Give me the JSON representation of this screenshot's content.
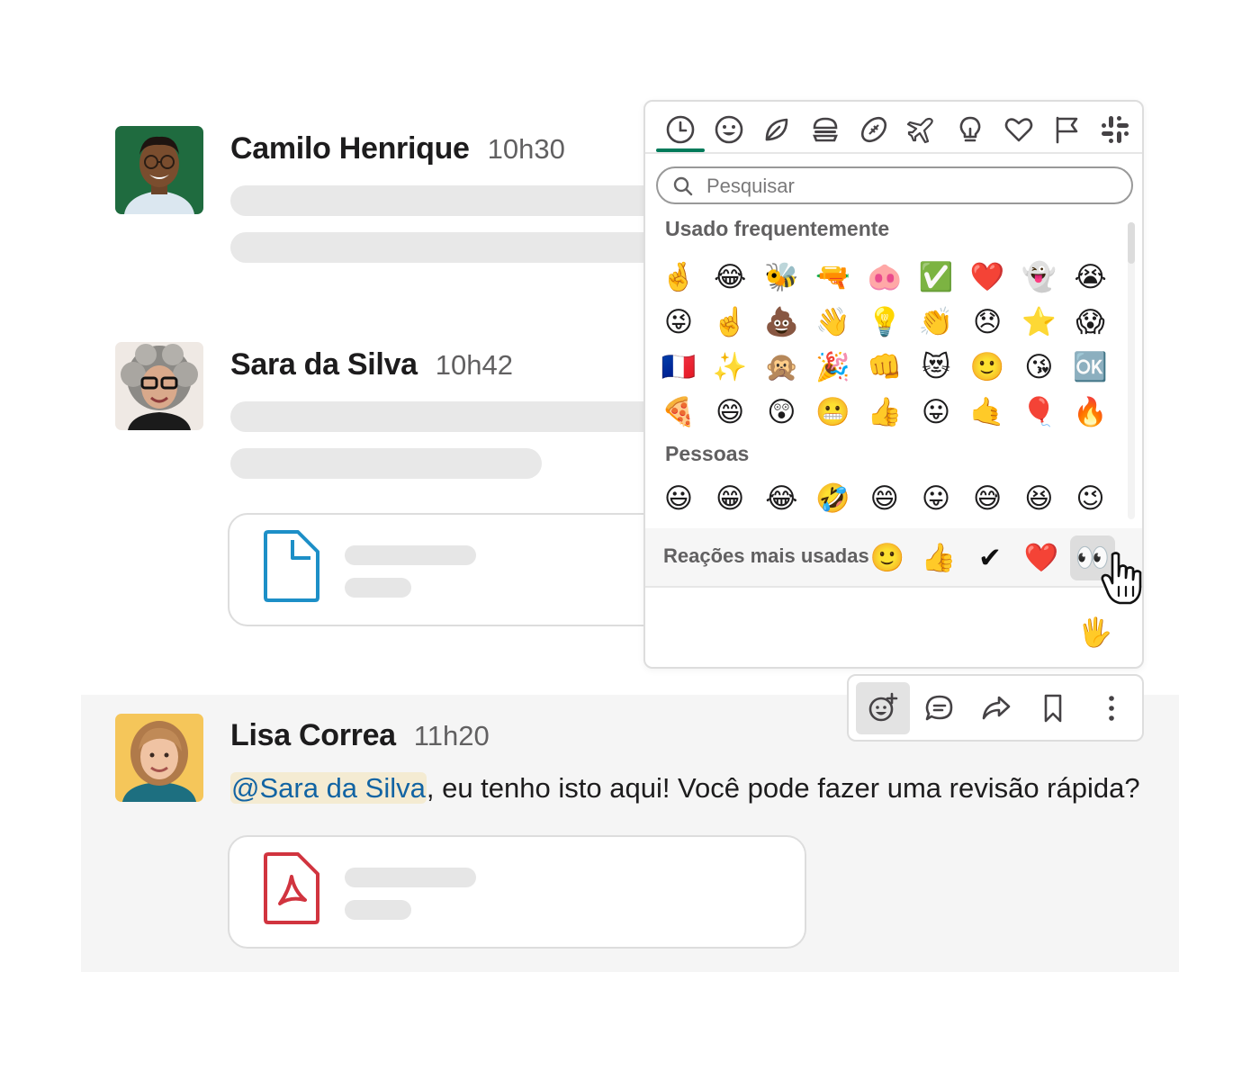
{
  "messages": [
    {
      "author": "Camilo Henrique",
      "time": "10h30"
    },
    {
      "author": "Sara da Silva",
      "time": "10h42"
    },
    {
      "author": "Lisa Correa",
      "time": "11h20",
      "mention": "@Sara da Silva",
      "text": ", eu tenho isto aqui! Você pode fazer uma revisão rápida?"
    }
  ],
  "attachments": [
    {
      "kind": "document",
      "icon": "document-icon",
      "color": "#1d8fc7"
    },
    {
      "kind": "pdf",
      "icon": "pdf-icon",
      "color": "#d1343f"
    }
  ],
  "emoji_picker": {
    "categories": [
      "clock-icon",
      "smiley-icon",
      "leaf-icon",
      "burger-icon",
      "football-icon",
      "airplane-icon",
      "lightbulb-icon",
      "heart-icon",
      "flag-icon",
      "slack-icon"
    ],
    "active_category": "clock-icon",
    "search_placeholder": "Pesquisar",
    "frequent_title": "Usado frequentemente",
    "frequent": [
      "🤞",
      "😂",
      "🐝",
      "🔫",
      "🐽",
      "✅",
      "❤️",
      "👻",
      "😭",
      "😜",
      "☝️",
      "💩",
      "👋",
      "💡",
      "👏",
      "😞",
      "⭐",
      "😱",
      "🇫🇷",
      "✨",
      "🙊",
      "🎉",
      "👊",
      "😻",
      "🙂",
      "😘",
      "🆗",
      "🍕",
      "😄",
      "😲",
      "😬",
      "👍",
      "😛",
      "🤙",
      "🎈",
      "🔥"
    ],
    "people_title": "Pessoas",
    "people": [
      "😃",
      "😁",
      "😂",
      "🤣",
      "😄",
      "😛",
      "😅",
      "😆",
      "😉"
    ],
    "reactions_label": "Reações mais usadas",
    "reactions": [
      "🙂",
      "👍",
      "✔",
      "❤️",
      "👀"
    ],
    "hovered_reaction": "👀",
    "skin_tone": "🖐️"
  },
  "actions_toolbar": [
    "add-reaction-icon",
    "reply-thread-icon",
    "share-arrow-icon",
    "bookmark-icon",
    "more-options-icon"
  ],
  "colors": {
    "accent_green": "#007a5a",
    "mention_bg": "#f4ebd2",
    "mention_text": "#1264a3"
  }
}
